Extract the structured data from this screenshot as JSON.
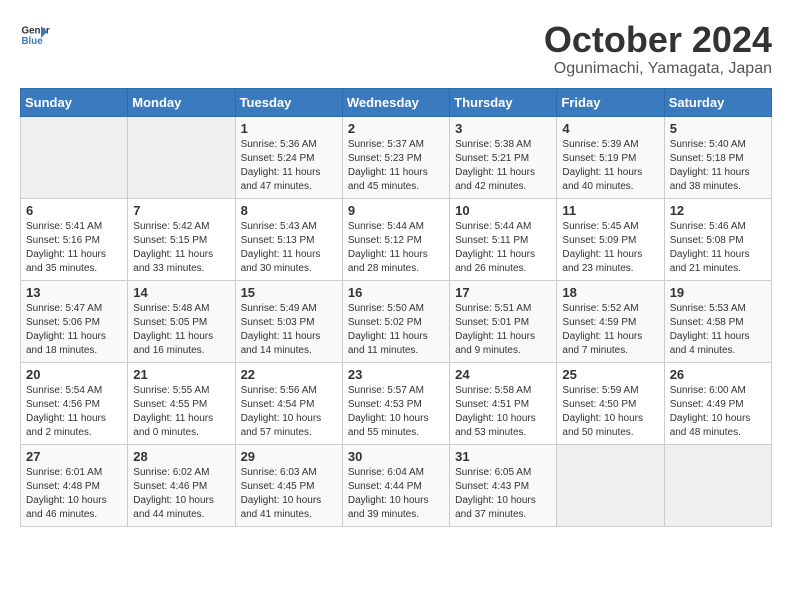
{
  "logo": {
    "line1": "General",
    "line2": "Blue"
  },
  "title": "October 2024",
  "location": "Ogunimachi, Yamagata, Japan",
  "days_of_week": [
    "Sunday",
    "Monday",
    "Tuesday",
    "Wednesday",
    "Thursday",
    "Friday",
    "Saturday"
  ],
  "weeks": [
    [
      {
        "day": "",
        "sunrise": "",
        "sunset": "",
        "daylight": ""
      },
      {
        "day": "",
        "sunrise": "",
        "sunset": "",
        "daylight": ""
      },
      {
        "day": "1",
        "sunrise": "Sunrise: 5:36 AM",
        "sunset": "Sunset: 5:24 PM",
        "daylight": "Daylight: 11 hours and 47 minutes."
      },
      {
        "day": "2",
        "sunrise": "Sunrise: 5:37 AM",
        "sunset": "Sunset: 5:23 PM",
        "daylight": "Daylight: 11 hours and 45 minutes."
      },
      {
        "day": "3",
        "sunrise": "Sunrise: 5:38 AM",
        "sunset": "Sunset: 5:21 PM",
        "daylight": "Daylight: 11 hours and 42 minutes."
      },
      {
        "day": "4",
        "sunrise": "Sunrise: 5:39 AM",
        "sunset": "Sunset: 5:19 PM",
        "daylight": "Daylight: 11 hours and 40 minutes."
      },
      {
        "day": "5",
        "sunrise": "Sunrise: 5:40 AM",
        "sunset": "Sunset: 5:18 PM",
        "daylight": "Daylight: 11 hours and 38 minutes."
      }
    ],
    [
      {
        "day": "6",
        "sunrise": "Sunrise: 5:41 AM",
        "sunset": "Sunset: 5:16 PM",
        "daylight": "Daylight: 11 hours and 35 minutes."
      },
      {
        "day": "7",
        "sunrise": "Sunrise: 5:42 AM",
        "sunset": "Sunset: 5:15 PM",
        "daylight": "Daylight: 11 hours and 33 minutes."
      },
      {
        "day": "8",
        "sunrise": "Sunrise: 5:43 AM",
        "sunset": "Sunset: 5:13 PM",
        "daylight": "Daylight: 11 hours and 30 minutes."
      },
      {
        "day": "9",
        "sunrise": "Sunrise: 5:44 AM",
        "sunset": "Sunset: 5:12 PM",
        "daylight": "Daylight: 11 hours and 28 minutes."
      },
      {
        "day": "10",
        "sunrise": "Sunrise: 5:44 AM",
        "sunset": "Sunset: 5:11 PM",
        "daylight": "Daylight: 11 hours and 26 minutes."
      },
      {
        "day": "11",
        "sunrise": "Sunrise: 5:45 AM",
        "sunset": "Sunset: 5:09 PM",
        "daylight": "Daylight: 11 hours and 23 minutes."
      },
      {
        "day": "12",
        "sunrise": "Sunrise: 5:46 AM",
        "sunset": "Sunset: 5:08 PM",
        "daylight": "Daylight: 11 hours and 21 minutes."
      }
    ],
    [
      {
        "day": "13",
        "sunrise": "Sunrise: 5:47 AM",
        "sunset": "Sunset: 5:06 PM",
        "daylight": "Daylight: 11 hours and 18 minutes."
      },
      {
        "day": "14",
        "sunrise": "Sunrise: 5:48 AM",
        "sunset": "Sunset: 5:05 PM",
        "daylight": "Daylight: 11 hours and 16 minutes."
      },
      {
        "day": "15",
        "sunrise": "Sunrise: 5:49 AM",
        "sunset": "Sunset: 5:03 PM",
        "daylight": "Daylight: 11 hours and 14 minutes."
      },
      {
        "day": "16",
        "sunrise": "Sunrise: 5:50 AM",
        "sunset": "Sunset: 5:02 PM",
        "daylight": "Daylight: 11 hours and 11 minutes."
      },
      {
        "day": "17",
        "sunrise": "Sunrise: 5:51 AM",
        "sunset": "Sunset: 5:01 PM",
        "daylight": "Daylight: 11 hours and 9 minutes."
      },
      {
        "day": "18",
        "sunrise": "Sunrise: 5:52 AM",
        "sunset": "Sunset: 4:59 PM",
        "daylight": "Daylight: 11 hours and 7 minutes."
      },
      {
        "day": "19",
        "sunrise": "Sunrise: 5:53 AM",
        "sunset": "Sunset: 4:58 PM",
        "daylight": "Daylight: 11 hours and 4 minutes."
      }
    ],
    [
      {
        "day": "20",
        "sunrise": "Sunrise: 5:54 AM",
        "sunset": "Sunset: 4:56 PM",
        "daylight": "Daylight: 11 hours and 2 minutes."
      },
      {
        "day": "21",
        "sunrise": "Sunrise: 5:55 AM",
        "sunset": "Sunset: 4:55 PM",
        "daylight": "Daylight: 11 hours and 0 minutes."
      },
      {
        "day": "22",
        "sunrise": "Sunrise: 5:56 AM",
        "sunset": "Sunset: 4:54 PM",
        "daylight": "Daylight: 10 hours and 57 minutes."
      },
      {
        "day": "23",
        "sunrise": "Sunrise: 5:57 AM",
        "sunset": "Sunset: 4:53 PM",
        "daylight": "Daylight: 10 hours and 55 minutes."
      },
      {
        "day": "24",
        "sunrise": "Sunrise: 5:58 AM",
        "sunset": "Sunset: 4:51 PM",
        "daylight": "Daylight: 10 hours and 53 minutes."
      },
      {
        "day": "25",
        "sunrise": "Sunrise: 5:59 AM",
        "sunset": "Sunset: 4:50 PM",
        "daylight": "Daylight: 10 hours and 50 minutes."
      },
      {
        "day": "26",
        "sunrise": "Sunrise: 6:00 AM",
        "sunset": "Sunset: 4:49 PM",
        "daylight": "Daylight: 10 hours and 48 minutes."
      }
    ],
    [
      {
        "day": "27",
        "sunrise": "Sunrise: 6:01 AM",
        "sunset": "Sunset: 4:48 PM",
        "daylight": "Daylight: 10 hours and 46 minutes."
      },
      {
        "day": "28",
        "sunrise": "Sunrise: 6:02 AM",
        "sunset": "Sunset: 4:46 PM",
        "daylight": "Daylight: 10 hours and 44 minutes."
      },
      {
        "day": "29",
        "sunrise": "Sunrise: 6:03 AM",
        "sunset": "Sunset: 4:45 PM",
        "daylight": "Daylight: 10 hours and 41 minutes."
      },
      {
        "day": "30",
        "sunrise": "Sunrise: 6:04 AM",
        "sunset": "Sunset: 4:44 PM",
        "daylight": "Daylight: 10 hours and 39 minutes."
      },
      {
        "day": "31",
        "sunrise": "Sunrise: 6:05 AM",
        "sunset": "Sunset: 4:43 PM",
        "daylight": "Daylight: 10 hours and 37 minutes."
      },
      {
        "day": "",
        "sunrise": "",
        "sunset": "",
        "daylight": ""
      },
      {
        "day": "",
        "sunrise": "",
        "sunset": "",
        "daylight": ""
      }
    ]
  ]
}
